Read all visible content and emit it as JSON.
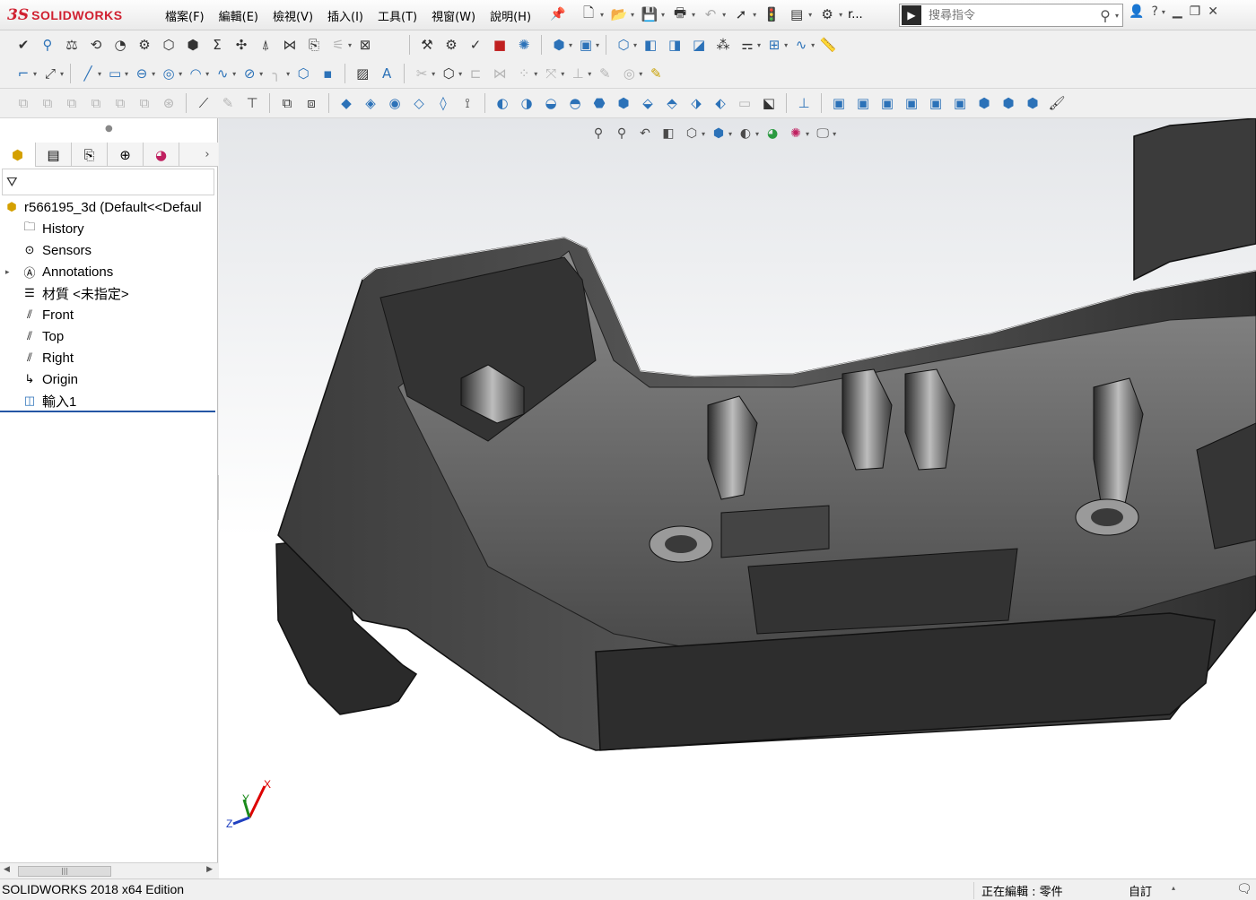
{
  "app": {
    "logo_prefix": "3S",
    "logo_text": "SOLIDWORKS"
  },
  "menus": [
    "檔案(F)",
    "編輯(E)",
    "檢視(V)",
    "插入(I)",
    "工具(T)",
    "視窗(W)",
    "說明(H)"
  ],
  "quickbar": {
    "recent_doc_label": "r..."
  },
  "search": {
    "placeholder": "搜尋指令"
  },
  "colors": {
    "brand": "#d02030",
    "accent": "#2a7bd0",
    "tree_selection_line": "#2456a4",
    "part_body": "#3a3a3a"
  },
  "feature_tree": {
    "root": "r566195_3d  (Default<<Defaul",
    "items": [
      {
        "label": "History",
        "icon": "history-folder-icon"
      },
      {
        "label": "Sensors",
        "icon": "sensors-icon"
      },
      {
        "label": "Annotations",
        "icon": "annotations-icon",
        "expandable": true
      },
      {
        "label": "材質 <未指定>",
        "icon": "material-icon"
      },
      {
        "label": "Front",
        "icon": "plane-icon"
      },
      {
        "label": "Top",
        "icon": "plane-icon"
      },
      {
        "label": "Right",
        "icon": "plane-icon"
      },
      {
        "label": "Origin",
        "icon": "origin-icon"
      },
      {
        "label": "輸入1",
        "icon": "imported-body-icon"
      }
    ]
  },
  "triad": {
    "x": "X",
    "y": "Y",
    "z": "Z"
  },
  "status": {
    "version": "SOLIDWORKS 2018 x64 Edition",
    "mode": "正在編輯 : 零件",
    "custom": "自訂"
  }
}
